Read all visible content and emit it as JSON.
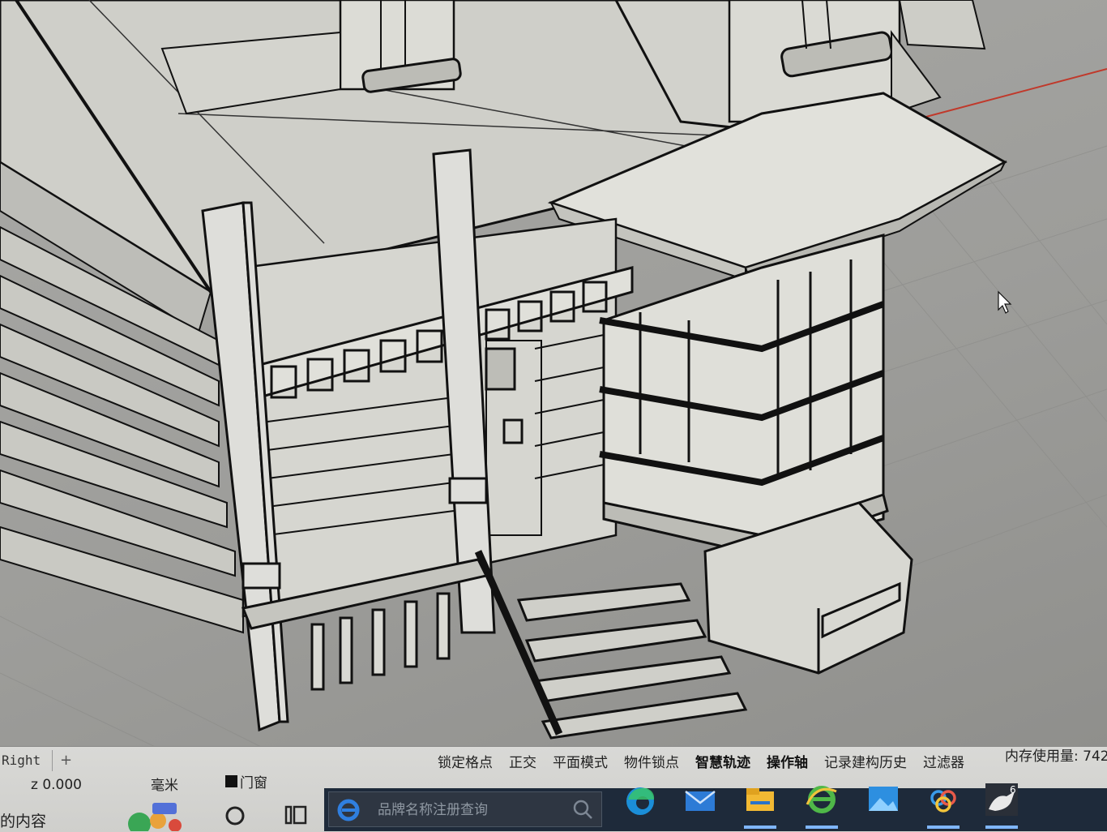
{
  "viewport": {
    "name": "Right",
    "add_tab": "+"
  },
  "status": {
    "coordinate": "z 0.000",
    "unit": "毫米",
    "layer": "门窗",
    "osnap_items": [
      {
        "label": "锁定格点",
        "on": false
      },
      {
        "label": "正交",
        "on": false
      },
      {
        "label": "平面模式",
        "on": false
      },
      {
        "label": "物件锁点",
        "on": false
      },
      {
        "label": "智慧轨迹",
        "on": true
      },
      {
        "label": "操作轴",
        "on": true
      },
      {
        "label": "记录建构历史",
        "on": false
      },
      {
        "label": "过滤器",
        "on": false
      }
    ],
    "memory": "内存使用量: 742"
  },
  "left_panel": {
    "partial_text": "的内容"
  },
  "taskbar": {
    "search_placeholder": "品牌名称注册查询",
    "icons": [
      "edge-icon",
      "mail-icon",
      "file-explorer-icon",
      "ie-icon",
      "photos-icon",
      "baidu-netdisk-icon",
      "rhino-icon"
    ],
    "rhino_badge": "6"
  },
  "colors": {
    "viewport_bg": "#9d9d9a",
    "model_fill": "#d7d7d2",
    "wire": "#111111",
    "x_axis": "#c0392b",
    "taskbar": "#1e2a3a"
  }
}
